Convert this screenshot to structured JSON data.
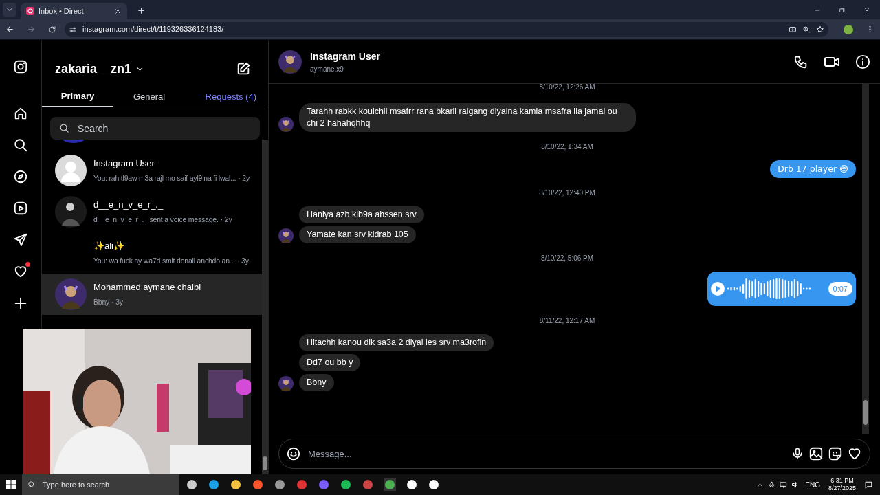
{
  "browser": {
    "tab_title": "Inbox • Direct",
    "url": "instagram.com/direct/t/119326336124183/"
  },
  "account": {
    "username": "zakaria__zn1"
  },
  "tabs": [
    {
      "label": "Primary",
      "selected": true,
      "kind": "normal"
    },
    {
      "label": "General",
      "selected": false,
      "kind": "normal"
    },
    {
      "label": "Requests (4)",
      "selected": false,
      "kind": "requests"
    }
  ],
  "search": {
    "placeholder": "Search"
  },
  "conversations": [
    {
      "name": "Instagram User",
      "preview": "You: rah tl9aw m3a rajl mo saif ayl9ina fi lwal...",
      "age": "· 2y",
      "selected": false,
      "kind": "blank"
    },
    {
      "name": "d__e_n_v_e_r_._",
      "preview": "d__e_n_v_e_r_._ sent a voice message.",
      "age": "· 2y",
      "selected": false
    },
    {
      "name": "✨ali✨",
      "preview": "You: wa fuck ay wa7d smit donali anchdo an...",
      "age": "· 3y",
      "selected": false,
      "kind": "none"
    },
    {
      "name": "Mohammed aymane chaibi",
      "preview": "Bbny",
      "age": "· 3y",
      "selected": true,
      "kind": "purple"
    }
  ],
  "chat": {
    "name": "Instagram User",
    "handle": "aymane.x9"
  },
  "messages": [
    {
      "kind": "time",
      "text": "8/10/22, 12:26 AM"
    },
    {
      "kind": "incoming",
      "text": "Tarahh rabkk koulchii msafrr rana bkarii ralgang diyalna kamla msafra ila jamal ou chi 2 hahahqhhq",
      "avatar": true
    },
    {
      "kind": "time",
      "text": "8/10/22, 1:34 AM"
    },
    {
      "kind": "outgoing",
      "text": "Drb 17 player 😅"
    },
    {
      "kind": "time",
      "text": "8/10/22, 12:40 PM"
    },
    {
      "kind": "incoming",
      "text": "Haniya azb kib9a ahssen srv",
      "avatar": false
    },
    {
      "kind": "incoming",
      "text": "Yamate kan srv kidrab 105",
      "avatar": true
    },
    {
      "kind": "time",
      "text": "8/10/22, 5:06 PM"
    },
    {
      "kind": "voice",
      "text": "0:07"
    },
    {
      "kind": "time",
      "text": "8/11/22, 12:17 AM"
    },
    {
      "kind": "incoming",
      "text": "Hitachh kanou dik sa3a 2 diyal les srv ma3rofin",
      "avatar": false
    },
    {
      "kind": "incoming",
      "text": "Dd7 ou bb y",
      "avatar": false
    },
    {
      "kind": "incoming",
      "text": "Bbny",
      "avatar": true
    }
  ],
  "composer": {
    "placeholder": "Message..."
  },
  "taskbar": {
    "search_placeholder": "Type here to search",
    "language": "ENG",
    "time": "6:31 PM",
    "date": "8/27/2025"
  }
}
